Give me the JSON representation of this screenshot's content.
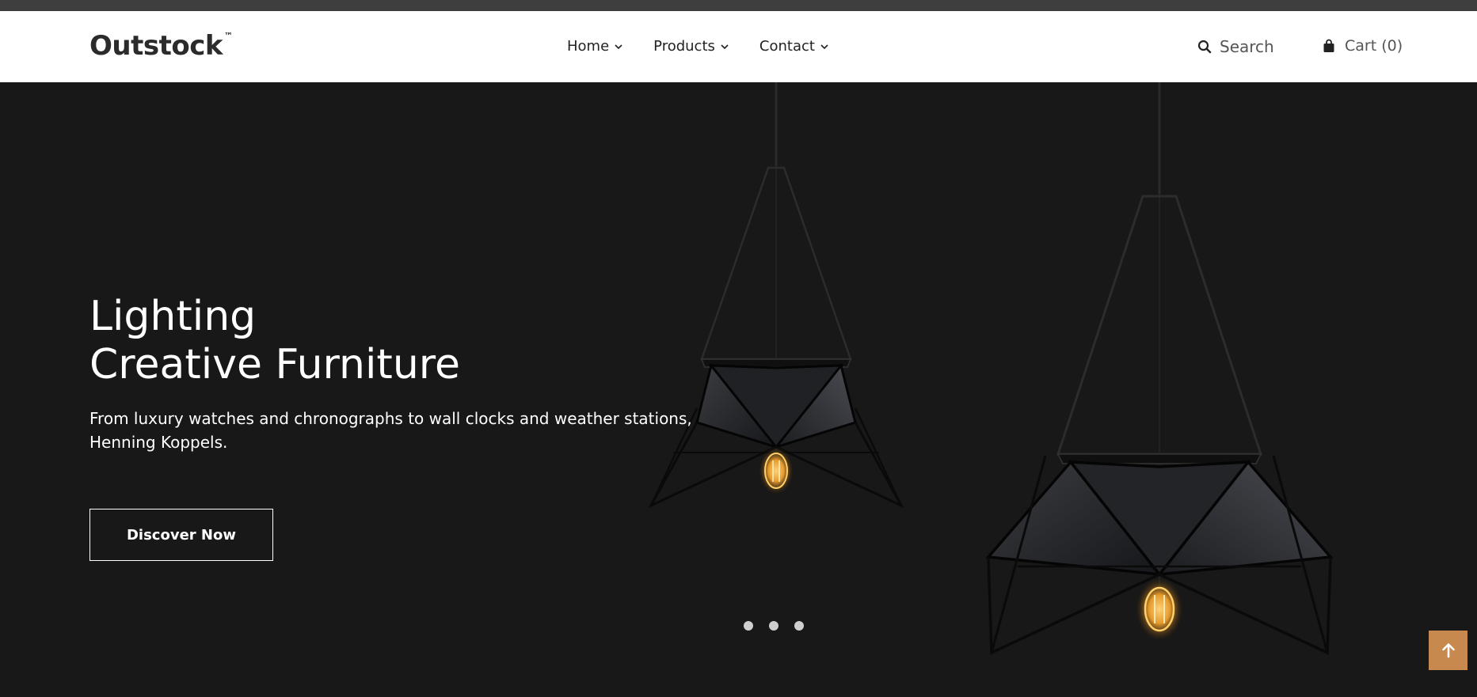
{
  "brand": {
    "name": "Outstock",
    "trademark": "™"
  },
  "nav": {
    "items": [
      {
        "label": "Home"
      },
      {
        "label": "Products"
      },
      {
        "label": "Contact"
      }
    ]
  },
  "header": {
    "search_label": "Search",
    "cart_label": "Cart (0)"
  },
  "hero": {
    "title_line1": "Lighting",
    "title_line2": "Creative Furniture",
    "description_line1": "From luxury watches and chronographs to wall clocks and weather stations,",
    "description_line2": "Henning Koppels.",
    "cta_label": "Discover Now",
    "slider_dots": 3,
    "image_content": "two black geometric pendant lamps with lit bulbs"
  },
  "colors": {
    "topbar": "#3e3e3e",
    "hero_background": "#181818",
    "back_to_top": "#c8894f"
  },
  "icons": {
    "search": "search-icon",
    "cart": "shopping-bag-icon",
    "chevron": "chevron-down-icon",
    "back_to_top": "arrow-up-icon"
  }
}
